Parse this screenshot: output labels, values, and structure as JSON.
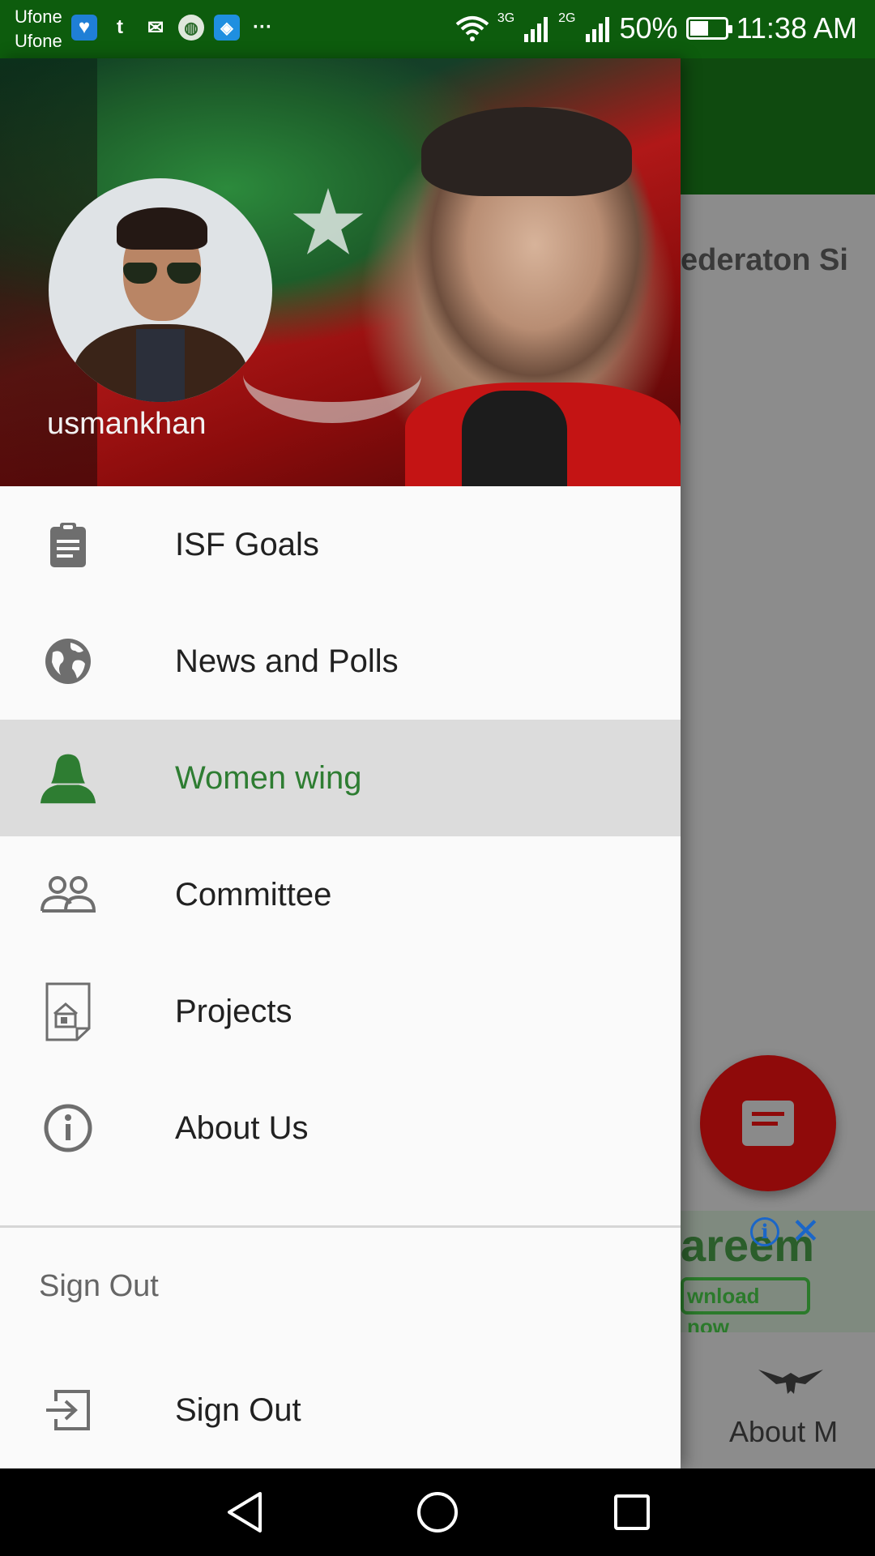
{
  "status_bar": {
    "carrier_1": "Ufone",
    "carrier_2": "Ufone",
    "more": "···",
    "net_1": "3G",
    "net_2": "2G",
    "battery": "50%",
    "time": "11:38 AM",
    "icons": [
      "health-app-icon",
      "tumblr-icon",
      "gmail-icon",
      "browser-icon",
      "shareit-icon",
      "more-icon",
      "wifi-icon",
      "signal-icon",
      "battery-icon"
    ]
  },
  "drawer": {
    "username": "usmankhan",
    "items": [
      {
        "label": "ISF Goals",
        "icon": "clipboard-icon"
      },
      {
        "label": "News and Polls",
        "icon": "globe-icon"
      },
      {
        "label": "Women wing",
        "icon": "woman-icon",
        "active": true
      },
      {
        "label": "Committee",
        "icon": "people-icon"
      },
      {
        "label": "Projects",
        "icon": "document-icon"
      },
      {
        "label": "About Us",
        "icon": "info-icon"
      }
    ],
    "section_header": "Sign Out",
    "sign_out_label": "Sign Out",
    "colors": {
      "accent": "#2e7d32",
      "active_bg": "#dcdcdc",
      "status_bar": "#0d5c0d"
    }
  },
  "background_app": {
    "heading": "ederaton Si",
    "ad": {
      "text": "areem",
      "download": "wnload now",
      "info": "i",
      "close": "✕"
    },
    "bottom_nav_label": "About M"
  },
  "nav_bar": {
    "icons": [
      "back-icon",
      "home-icon",
      "recents-icon"
    ]
  }
}
